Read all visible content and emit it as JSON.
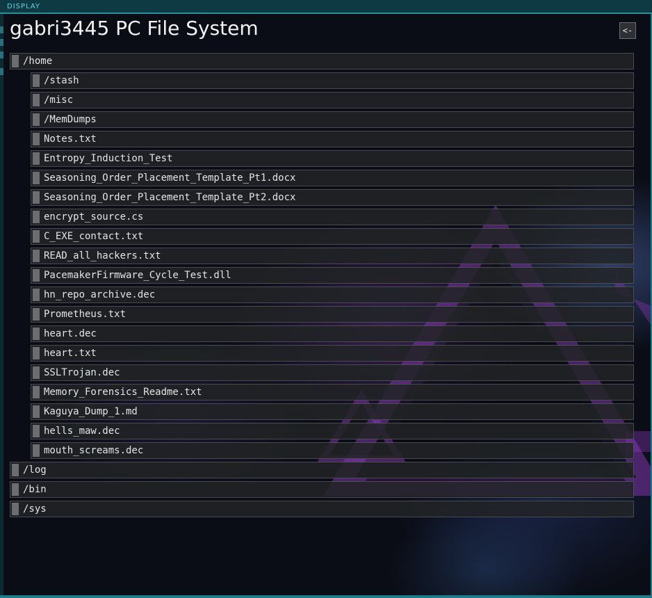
{
  "window": {
    "label": "DISPLAY"
  },
  "header": {
    "title": "gabri3445 PC File System",
    "back_label": "<-"
  },
  "tree": {
    "root": {
      "label": "/home"
    },
    "home_children": [
      "/stash",
      "/misc",
      "/MemDumps",
      "Notes.txt",
      "Entropy_Induction_Test",
      "Seasoning_Order_Placement_Template_Pt1.docx",
      "Seasoning_Order_Placement_Template_Pt2.docx",
      "encrypt_source.cs",
      "C_EXE_contact.txt",
      "READ_all_hackers.txt",
      "PacemakerFirmware_Cycle_Test.dll",
      "hn_repo_archive.dec",
      "Prometheus.txt",
      "heart.dec",
      "heart.txt",
      "SSLTrojan.dec",
      "Memory_Forensics_Readme.txt",
      "Kaguya_Dump_1.md",
      "hells_maw.dec",
      "mouth_screams.dec"
    ],
    "other_folders": [
      "/log",
      "/bin",
      "/sys"
    ]
  },
  "colors": {
    "accent": "#2b8fa0",
    "row_bg": "#222426",
    "row_marker": "#6b6d70",
    "text": "#e4e4e4",
    "triangle": "#8a3fc0"
  }
}
